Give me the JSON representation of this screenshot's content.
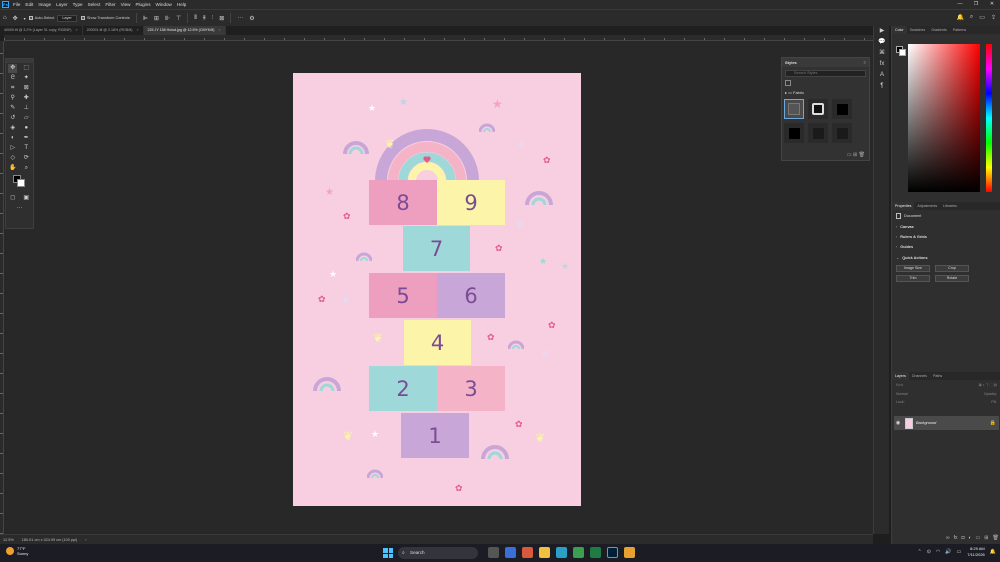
{
  "app": {
    "logo": "Ps"
  },
  "menu": [
    "File",
    "Edit",
    "Image",
    "Layer",
    "Type",
    "Select",
    "Filter",
    "View",
    "Plugins",
    "Window",
    "Help"
  ],
  "window_controls": [
    "—",
    "❐",
    "✕"
  ],
  "options_bar": {
    "auto_select_label": "Auto-Select",
    "auto_select_target": "Layer",
    "show_transform_label": "Show Transform Controls",
    "more_icon": "···"
  },
  "tabs": [
    {
      "label": "40000.tif @ 3.2% (Layer 31 copy, RGB/8*)",
      "active": false
    },
    {
      "label": "200001.tif @ 2.18% (RGB/8)",
      "active": false
    },
    {
      "label": "225 JY 158 Hulud.jpg @ 12.5% (CMYK/8)",
      "active": true
    }
  ],
  "hopscotch": {
    "bg_color": "#f7cfe0",
    "squares": [
      {
        "number": "8",
        "color": "#ee9fc0"
      },
      {
        "number": "9",
        "color": "#fcf4a8"
      },
      {
        "number": "7",
        "color": "#9ed8d8"
      },
      {
        "number": "5",
        "color": "#ee9fc0"
      },
      {
        "number": "6",
        "color": "#c8a7d8"
      },
      {
        "number": "4",
        "color": "#fcf4a8"
      },
      {
        "number": "2",
        "color": "#9ed8d8"
      },
      {
        "number": "3",
        "color": "#f5b3c8"
      },
      {
        "number": "1",
        "color": "#c8a7d8"
      }
    ]
  },
  "styles_panel": {
    "title": "Styles",
    "search_placeholder": "Search Styles",
    "folder_label": "Fabric"
  },
  "color_panel": {
    "tabs": [
      "Color",
      "Swatches",
      "Gradients",
      "Patterns"
    ]
  },
  "properties_panel": {
    "tabs": [
      "Properties",
      "Adjustments",
      "Libraries"
    ],
    "doc_label": "Document",
    "sections": [
      "Canvas",
      "Rulers & Grids",
      "Guides",
      "Quick Actions"
    ],
    "quick_actions": [
      "Image Size",
      "Crop",
      "Trim",
      "Rotate"
    ]
  },
  "layers_panel": {
    "tabs": [
      "Layers",
      "Channels",
      "Paths"
    ],
    "kind_placeholder": "Kind",
    "blend_mode": "Normal",
    "opacity_label": "Opacity:",
    "lock_label": "Lock:",
    "fill_label": "Fill:",
    "layer_name": "Background"
  },
  "status": {
    "zoom": "12.5%",
    "info": "180.01 cm x 324.99 cm (100 ppi)",
    "arrow": "›"
  },
  "taskbar": {
    "weather_temp": "77°F",
    "weather_desc": "Sunny",
    "search_label": "Search",
    "time": "8:29 AM",
    "date": "7/11/2026"
  }
}
